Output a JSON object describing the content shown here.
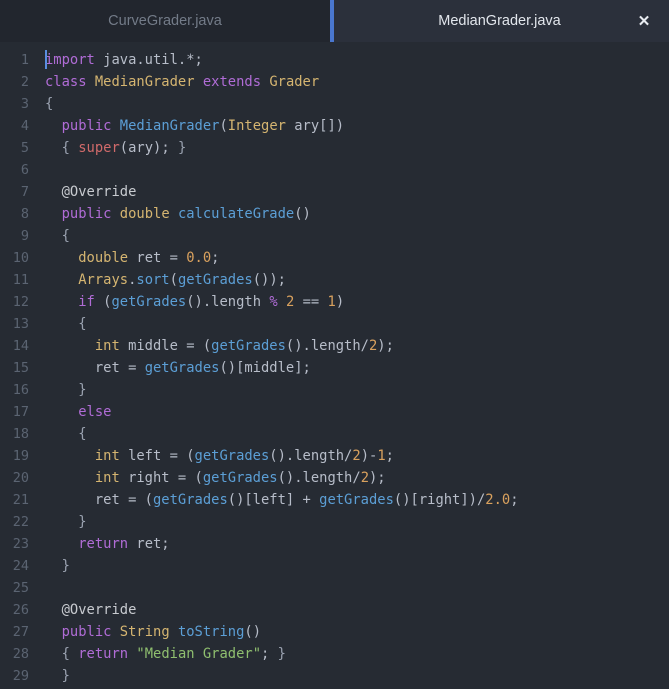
{
  "tabs": [
    {
      "label": "CurveGrader.java",
      "active": false
    },
    {
      "label": "MedianGrader.java",
      "active": true
    }
  ],
  "close_button": {
    "glyph": "✕"
  },
  "colors": {
    "tabbar_bg": "#22262e",
    "tab_active_bg": "#2b303b",
    "tab_accent": "#4a77cf",
    "editor_bg": "#262b33",
    "gutter_text": "#5b6472",
    "default_text": "#b7bdc9",
    "keyword": "#b06cd6",
    "type": "#d5b571",
    "function": "#5c9fd6",
    "number": "#d9a15e",
    "string": "#8fbf6f",
    "super": "#d06a6a",
    "annotation": "#c8cbd0",
    "caret": "#5a8de0"
  },
  "editor": {
    "language": "java",
    "caret": {
      "line": 1,
      "column": 1
    },
    "line_numbers": [
      1,
      2,
      3,
      4,
      5,
      6,
      7,
      8,
      9,
      10,
      11,
      12,
      13,
      14,
      15,
      16,
      17,
      18,
      19,
      20,
      21,
      22,
      23,
      24,
      25,
      26,
      27,
      28,
      29
    ],
    "lines": [
      [
        {
          "t": "import",
          "c": "kw"
        },
        {
          "t": " java.util.*;",
          "c": "op"
        }
      ],
      [
        {
          "t": "class",
          "c": "kw"
        },
        {
          "t": " ",
          "c": "op"
        },
        {
          "t": "MedianGrader",
          "c": "type"
        },
        {
          "t": " ",
          "c": "op"
        },
        {
          "t": "extends",
          "c": "kw"
        },
        {
          "t": " ",
          "c": "op"
        },
        {
          "t": "Grader",
          "c": "type"
        }
      ],
      [
        {
          "t": "{",
          "c": "pun"
        }
      ],
      [
        {
          "t": "  ",
          "c": "op"
        },
        {
          "t": "public",
          "c": "kw"
        },
        {
          "t": " ",
          "c": "op"
        },
        {
          "t": "MedianGrader",
          "c": "fn"
        },
        {
          "t": "(",
          "c": "op"
        },
        {
          "t": "Integer",
          "c": "type"
        },
        {
          "t": " ary[])",
          "c": "op"
        }
      ],
      [
        {
          "t": "  ",
          "c": "op"
        },
        {
          "t": "{",
          "c": "pun"
        },
        {
          "t": " ",
          "c": "op"
        },
        {
          "t": "super",
          "c": "sup"
        },
        {
          "t": "(ary); ",
          "c": "op"
        },
        {
          "t": "}",
          "c": "pun"
        }
      ],
      [
        {
          "t": "",
          "c": "op"
        }
      ],
      [
        {
          "t": "  ",
          "c": "op"
        },
        {
          "t": "@Override",
          "c": "ann"
        }
      ],
      [
        {
          "t": "  ",
          "c": "op"
        },
        {
          "t": "public",
          "c": "kw"
        },
        {
          "t": " ",
          "c": "op"
        },
        {
          "t": "double",
          "c": "type"
        },
        {
          "t": " ",
          "c": "op"
        },
        {
          "t": "calculateGrade",
          "c": "fn"
        },
        {
          "t": "()",
          "c": "op"
        }
      ],
      [
        {
          "t": "  ",
          "c": "op"
        },
        {
          "t": "{",
          "c": "pun"
        }
      ],
      [
        {
          "t": "    ",
          "c": "op"
        },
        {
          "t": "double",
          "c": "type"
        },
        {
          "t": " ret = ",
          "c": "op"
        },
        {
          "t": "0.0",
          "c": "num"
        },
        {
          "t": ";",
          "c": "op"
        }
      ],
      [
        {
          "t": "    ",
          "c": "op"
        },
        {
          "t": "Arrays",
          "c": "type"
        },
        {
          "t": ".",
          "c": "op"
        },
        {
          "t": "sort",
          "c": "fn"
        },
        {
          "t": "(",
          "c": "op"
        },
        {
          "t": "getGrades",
          "c": "fn"
        },
        {
          "t": "());",
          "c": "op"
        }
      ],
      [
        {
          "t": "    ",
          "c": "op"
        },
        {
          "t": "if",
          "c": "kw"
        },
        {
          "t": " (",
          "c": "op"
        },
        {
          "t": "getGrades",
          "c": "fn"
        },
        {
          "t": "().length ",
          "c": "op"
        },
        {
          "t": "%",
          "c": "kw"
        },
        {
          "t": " ",
          "c": "op"
        },
        {
          "t": "2",
          "c": "num"
        },
        {
          "t": " == ",
          "c": "op"
        },
        {
          "t": "1",
          "c": "num"
        },
        {
          "t": ")",
          "c": "op"
        }
      ],
      [
        {
          "t": "    ",
          "c": "op"
        },
        {
          "t": "{",
          "c": "pun"
        }
      ],
      [
        {
          "t": "      ",
          "c": "op"
        },
        {
          "t": "int",
          "c": "type"
        },
        {
          "t": " middle = (",
          "c": "op"
        },
        {
          "t": "getGrades",
          "c": "fn"
        },
        {
          "t": "().length/",
          "c": "op"
        },
        {
          "t": "2",
          "c": "num"
        },
        {
          "t": ");",
          "c": "op"
        }
      ],
      [
        {
          "t": "      ",
          "c": "op"
        },
        {
          "t": "ret = ",
          "c": "op"
        },
        {
          "t": "getGrades",
          "c": "fn"
        },
        {
          "t": "()[middle];",
          "c": "op"
        }
      ],
      [
        {
          "t": "    ",
          "c": "op"
        },
        {
          "t": "}",
          "c": "pun"
        }
      ],
      [
        {
          "t": "    ",
          "c": "op"
        },
        {
          "t": "else",
          "c": "kw"
        }
      ],
      [
        {
          "t": "    ",
          "c": "op"
        },
        {
          "t": "{",
          "c": "pun"
        }
      ],
      [
        {
          "t": "      ",
          "c": "op"
        },
        {
          "t": "int",
          "c": "type"
        },
        {
          "t": " left = (",
          "c": "op"
        },
        {
          "t": "getGrades",
          "c": "fn"
        },
        {
          "t": "().length/",
          "c": "op"
        },
        {
          "t": "2",
          "c": "num"
        },
        {
          "t": ")-",
          "c": "op"
        },
        {
          "t": "1",
          "c": "num"
        },
        {
          "t": ";",
          "c": "op"
        }
      ],
      [
        {
          "t": "      ",
          "c": "op"
        },
        {
          "t": "int",
          "c": "type"
        },
        {
          "t": " right = (",
          "c": "op"
        },
        {
          "t": "getGrades",
          "c": "fn"
        },
        {
          "t": "().length/",
          "c": "op"
        },
        {
          "t": "2",
          "c": "num"
        },
        {
          "t": ");",
          "c": "op"
        }
      ],
      [
        {
          "t": "      ",
          "c": "op"
        },
        {
          "t": "ret = (",
          "c": "op"
        },
        {
          "t": "getGrades",
          "c": "fn"
        },
        {
          "t": "()[left] + ",
          "c": "op"
        },
        {
          "t": "getGrades",
          "c": "fn"
        },
        {
          "t": "()[right])/",
          "c": "op"
        },
        {
          "t": "2.0",
          "c": "num"
        },
        {
          "t": ";",
          "c": "op"
        }
      ],
      [
        {
          "t": "    ",
          "c": "op"
        },
        {
          "t": "}",
          "c": "pun"
        }
      ],
      [
        {
          "t": "    ",
          "c": "op"
        },
        {
          "t": "return",
          "c": "kw"
        },
        {
          "t": " ret;",
          "c": "op"
        }
      ],
      [
        {
          "t": "  ",
          "c": "op"
        },
        {
          "t": "}",
          "c": "pun"
        }
      ],
      [
        {
          "t": "",
          "c": "op"
        }
      ],
      [
        {
          "t": "  ",
          "c": "op"
        },
        {
          "t": "@Override",
          "c": "ann"
        }
      ],
      [
        {
          "t": "  ",
          "c": "op"
        },
        {
          "t": "public",
          "c": "kw"
        },
        {
          "t": " ",
          "c": "op"
        },
        {
          "t": "String",
          "c": "type"
        },
        {
          "t": " ",
          "c": "op"
        },
        {
          "t": "toString",
          "c": "fn"
        },
        {
          "t": "()",
          "c": "op"
        }
      ],
      [
        {
          "t": "  ",
          "c": "op"
        },
        {
          "t": "{",
          "c": "pun"
        },
        {
          "t": " ",
          "c": "op"
        },
        {
          "t": "return",
          "c": "kw"
        },
        {
          "t": " ",
          "c": "op"
        },
        {
          "t": "\"Median Grader\"",
          "c": "str"
        },
        {
          "t": "; ",
          "c": "op"
        },
        {
          "t": "}",
          "c": "pun"
        }
      ],
      [
        {
          "t": "  ",
          "c": "op"
        },
        {
          "t": "}",
          "c": "pun"
        }
      ]
    ]
  }
}
